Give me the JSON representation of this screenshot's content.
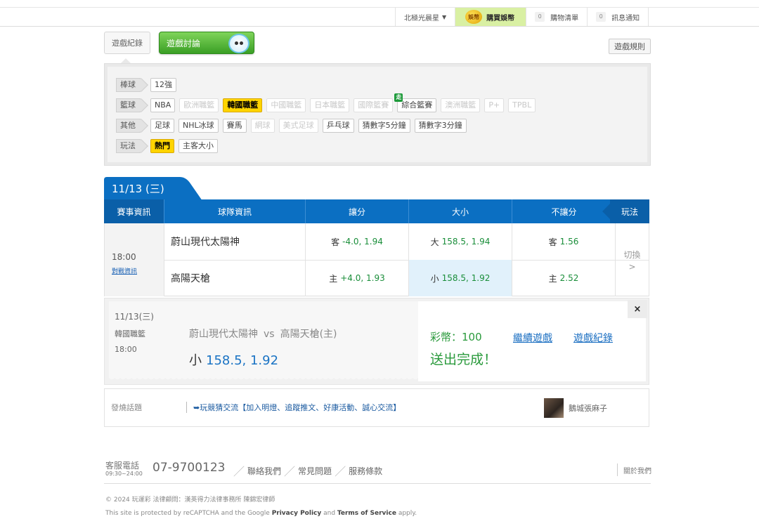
{
  "topbar": {
    "user": "北極光晨星",
    "buy": "購買娛幣",
    "coin_icon_text": "娛幣",
    "cart_count": "0",
    "cart": "購物清單",
    "notice_count": "0",
    "notice": "訊息通知"
  },
  "tabs": {
    "record": "遊戲紀錄",
    "discuss": "遊戲討論",
    "rules": "遊戲規則"
  },
  "filters": {
    "rows": [
      {
        "category": "棒球",
        "items": [
          {
            "label": "12強",
            "state": "normal"
          }
        ]
      },
      {
        "category": "籃球",
        "items": [
          {
            "label": "NBA",
            "state": "normal"
          },
          {
            "label": "歐洲職籃",
            "state": "disabled"
          },
          {
            "label": "韓國職籃",
            "state": "active"
          },
          {
            "label": "中國職籃",
            "state": "disabled"
          },
          {
            "label": "日本職籃",
            "state": "disabled"
          },
          {
            "label": "國際籃賽",
            "state": "disabled"
          },
          {
            "label": "綜合籃賽",
            "state": "normal",
            "badge": "走"
          },
          {
            "label": "澳洲職籃",
            "state": "disabled"
          },
          {
            "label": "P+",
            "state": "disabled"
          },
          {
            "label": "TPBL",
            "state": "disabled"
          }
        ]
      },
      {
        "category": "其他",
        "items": [
          {
            "label": "足球",
            "state": "normal"
          },
          {
            "label": "NHL冰球",
            "state": "normal"
          },
          {
            "label": "賽馬",
            "state": "normal"
          },
          {
            "label": "網球",
            "state": "disabled"
          },
          {
            "label": "美式足球",
            "state": "disabled"
          },
          {
            "label": "乒乓球",
            "state": "normal"
          },
          {
            "label": "猜數字5分鐘",
            "state": "normal"
          },
          {
            "label": "猜數字3分鐘",
            "state": "normal"
          }
        ]
      },
      {
        "category": "玩法",
        "items": [
          {
            "label": "熱門",
            "state": "active"
          },
          {
            "label": "主客大小",
            "state": "normal"
          }
        ]
      }
    ]
  },
  "date_tab": "11/13 (三)",
  "table": {
    "headers": [
      "賽事資訊",
      "球隊資訊",
      "讓分",
      "大小",
      "不讓分"
    ],
    "play_header": "玩法",
    "game": {
      "time": "18:00",
      "info_link": "對戰資訊",
      "switch_label": "切換",
      "switch_chevron": ">",
      "teams": [
        {
          "name": "蔚山現代太陽神",
          "spread_tag": "客",
          "spread": "-4.0, 1.94",
          "total_tag": "大",
          "total": "158.5, 1.94",
          "ml_tag": "客",
          "ml": "1.56"
        },
        {
          "name": "高陽天槍",
          "spread_tag": "主",
          "spread": "+4.0, 1.93",
          "total_tag": "小",
          "total": "158.5, 1.92",
          "ml_tag": "主",
          "ml": "2.52"
        }
      ]
    }
  },
  "confirm": {
    "date": "11/13(三)",
    "league": "韓國職籃",
    "time": "18:00",
    "away": "蔚山現代太陽神",
    "vs": "vs",
    "home": "高陽天槍(主)",
    "pick_tag": "小",
    "pick_value": "158.5, 1.92",
    "coins": "彩幣：100",
    "done": "送出完成！",
    "continue": "繼續遊戲",
    "history": "遊戲紀錄",
    "close": "×"
  },
  "discussion": {
    "label": "發燒話題",
    "topic": "➥玩競猜交流【加入明燈、追蹤推文、好康活動、誠心交流】",
    "user": "鵝城張麻子"
  },
  "footer": {
    "phone_label": "客服電話",
    "phone_hours": "09:30~24:00",
    "phone": "07-9700123",
    "links": [
      "聯絡我們",
      "常見問題",
      "服務條款"
    ],
    "about": "關於我們",
    "copyright": "© 2024 玩運彩 法律顧問：漢英得力法律事務所 陳錦宏律師",
    "recaptcha_pre": "This site is protected by reCAPTCHA and the Google",
    "privacy": "Privacy Policy",
    "and": "and",
    "terms": "Terms of Service",
    "apply": "apply."
  },
  "colors": {
    "header_blue": "#0b6fc2",
    "active_yellow": "#ffd400",
    "odds_green": "#1a8e3a",
    "link_blue": "#1b6fc2"
  }
}
